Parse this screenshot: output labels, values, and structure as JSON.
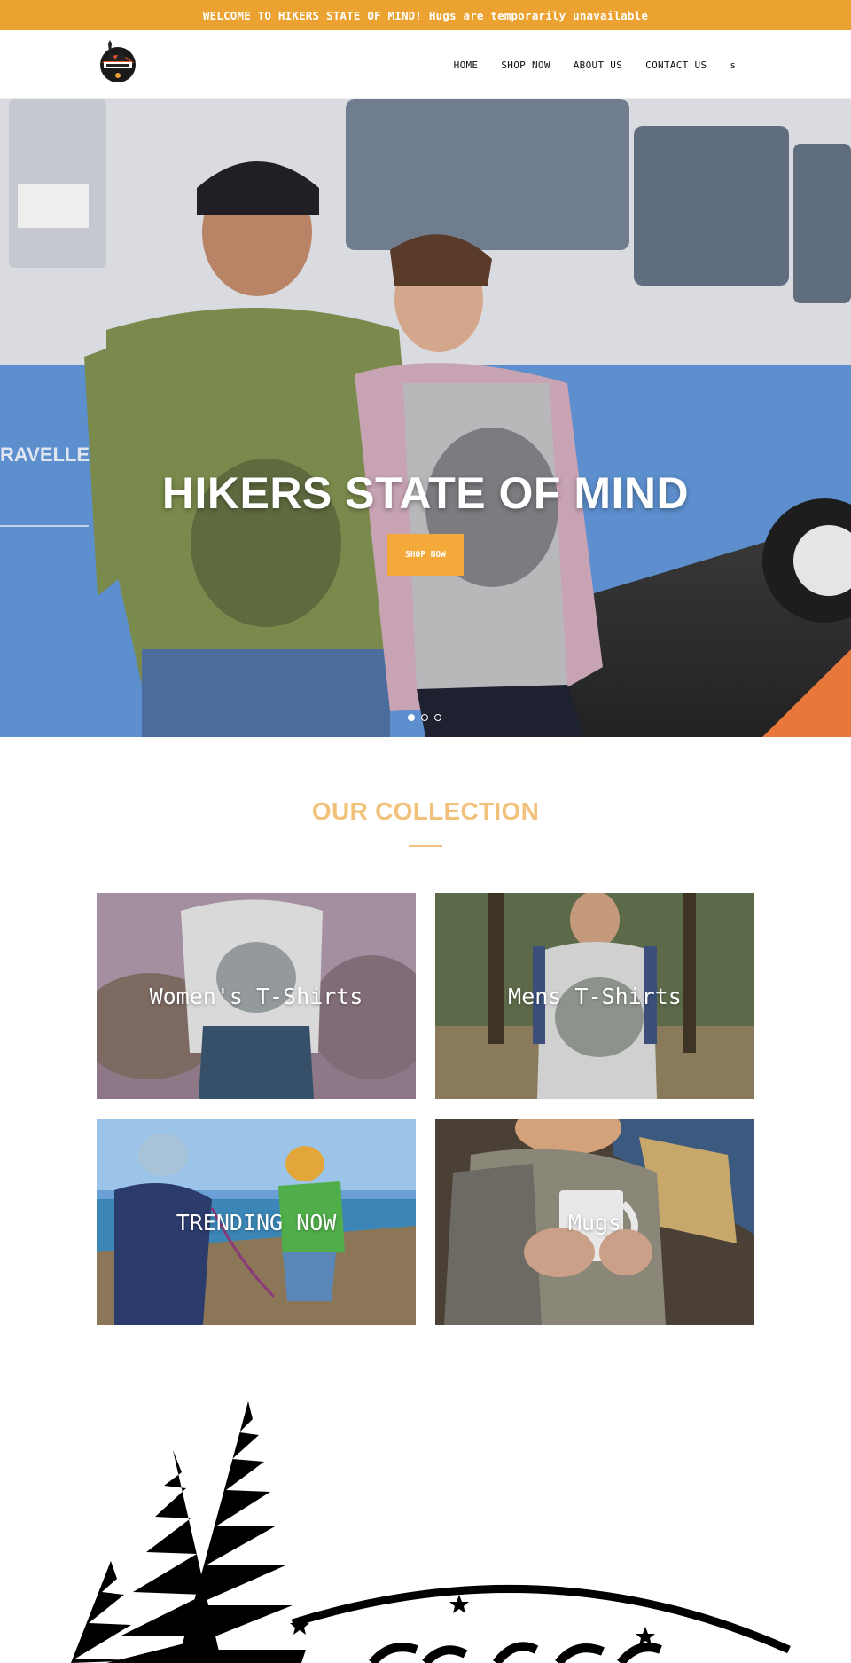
{
  "announcement": {
    "text": "WELCOME TO HIKERS STATE OF MIND! Hugs are temporarily unavailable"
  },
  "header": {
    "logo_name": "hikers-logo",
    "nav": [
      {
        "label": "HOME"
      },
      {
        "label": "SHOP NOW"
      },
      {
        "label": "ABOUT US"
      },
      {
        "label": "CONTACT US"
      }
    ],
    "search_glyph": "s"
  },
  "hero": {
    "title": "HIKERS STATE OF MIND",
    "button_label": "SHOP NOW",
    "slides": 3,
    "active_slide": 1
  },
  "collection": {
    "title": "OUR COLLECTION",
    "cards": [
      {
        "label": "Women's T-Shirts"
      },
      {
        "label": "Mens T-Shirts"
      },
      {
        "label": "TRENDING NOW"
      },
      {
        "label": "Mugs"
      }
    ]
  },
  "colors": {
    "accent": "#eca230",
    "button": "#f4a93a",
    "collection_title": "#f2c27c"
  }
}
